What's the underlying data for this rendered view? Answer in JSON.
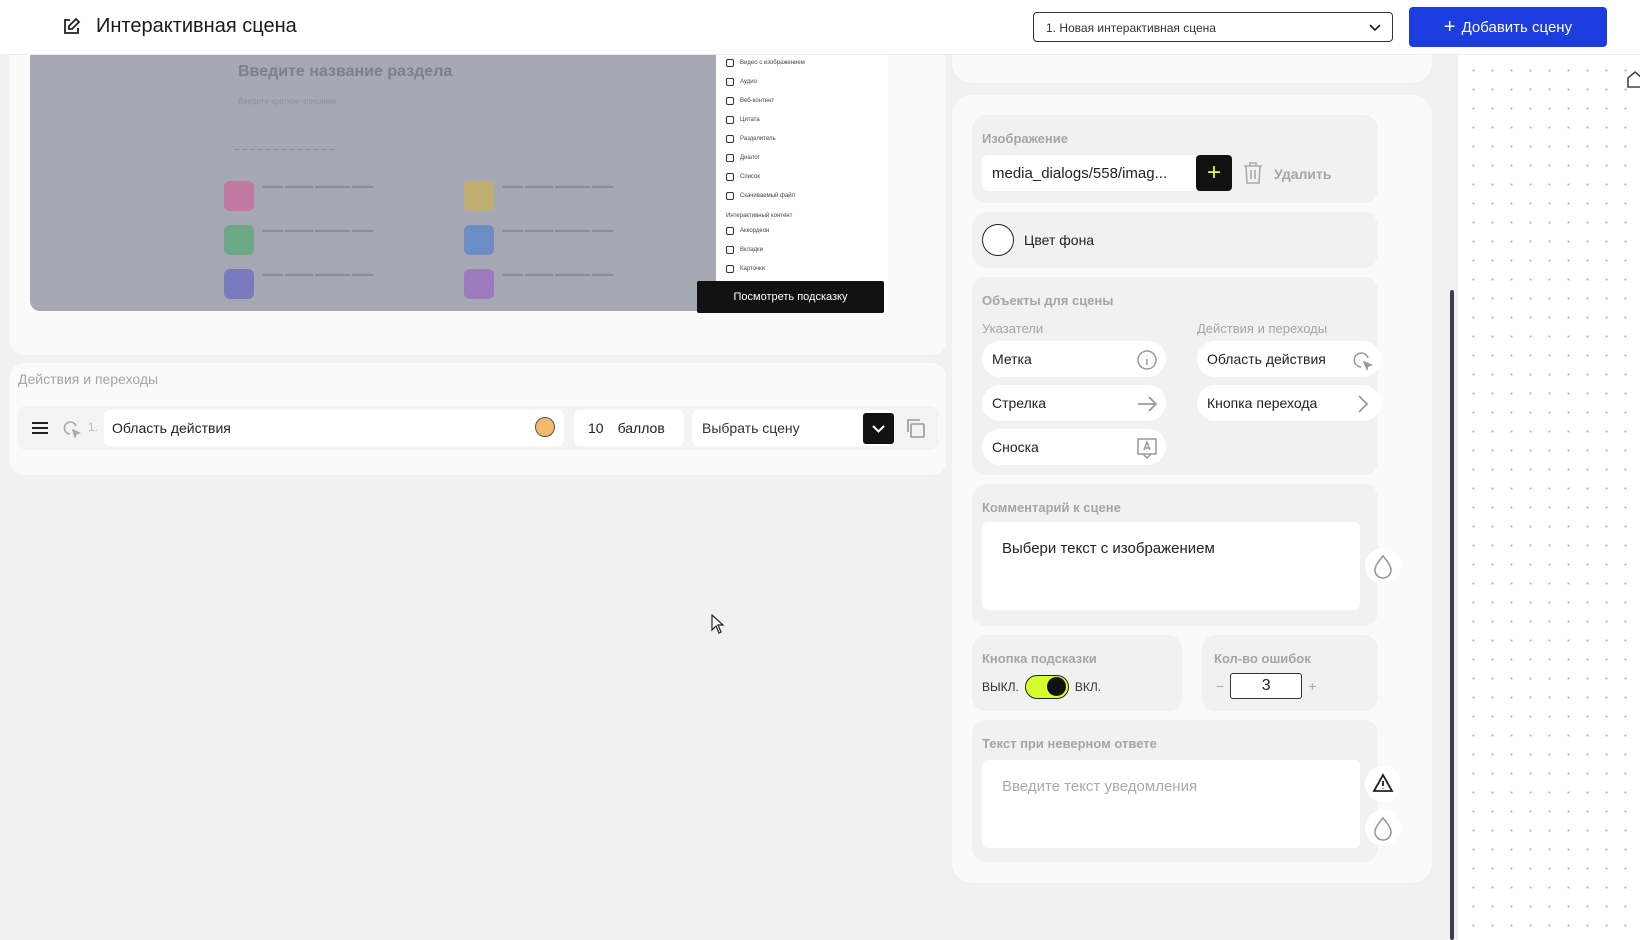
{
  "header": {
    "title": "Интерактивная сцена",
    "scene_select": "1. Новая интерактивная сцена",
    "add_button": "Добавить сцену"
  },
  "preview": {
    "section_title": "Введите название раздела",
    "section_subtitle": "Введите краткое описание",
    "side_menu": [
      "Видео с изображением",
      "Аудио",
      "Веб-контент",
      "Цитата",
      "Разделитель",
      "Диалог",
      "Список",
      "Скачиваемый файл",
      "Интерактивный контент",
      "Аккордеон",
      "Вкладки",
      "Карточки"
    ],
    "hint_button": "Посмотреть подсказку"
  },
  "actions": {
    "section_label": "Действия и переходы",
    "rows": [
      {
        "index": "1.",
        "name": "Область действия",
        "color": "#f5b96c",
        "points": "10",
        "points_unit": "баллов",
        "scene_placeholder": "Выбрать сцену"
      }
    ]
  },
  "panel": {
    "image": {
      "label": "Изображение",
      "file": "media_dialogs/558/imag...",
      "delete": "Удалить"
    },
    "background": {
      "label": "Цвет фона"
    },
    "objects": {
      "label": "Объекты для сцены",
      "pointers_label": "Указатели",
      "actions_label": "Действия и переходы",
      "pointers": [
        "Метка",
        "Стрелка",
        "Сноска"
      ],
      "actions": [
        "Область действия",
        "Кнопка перехода"
      ]
    },
    "comment": {
      "label": "Комментарий к сцене",
      "text": "Выбери текст с изображением"
    },
    "hint": {
      "label": "Кнопка подсказки",
      "off": "ВЫКЛ.",
      "on": "ВКЛ."
    },
    "errors": {
      "label": "Кол-во ошибок",
      "minus": "−",
      "value": "3",
      "plus": "+"
    },
    "wrong_text": {
      "label": "Текст при неверном ответе",
      "placeholder": "Введите текст уведомления"
    }
  },
  "colors": {
    "accent": "#1b3de0",
    "toggle": "#d4ff2a",
    "plus_glyph": "#e4ff3c"
  }
}
